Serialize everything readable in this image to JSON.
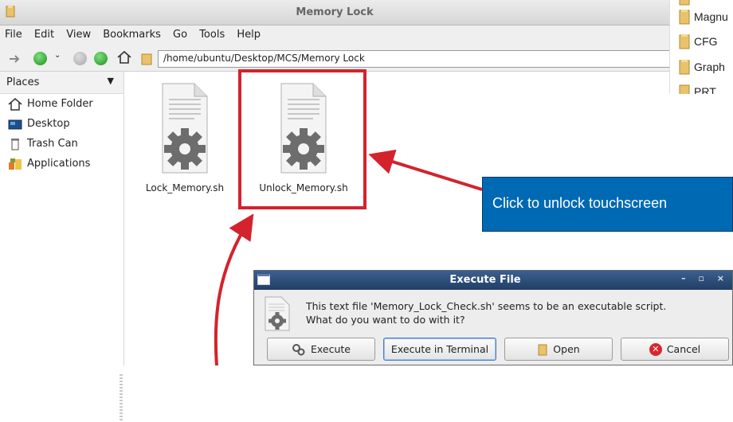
{
  "window": {
    "title": "Memory Lock"
  },
  "menu": [
    "File",
    "Edit",
    "View",
    "Bookmarks",
    "Go",
    "Tools",
    "Help"
  ],
  "toolbar": {
    "path": "/home/ubuntu/Desktop/MCS/Memory Lock"
  },
  "sidebar": {
    "header": "Places",
    "items": [
      {
        "label": "Home Folder",
        "icon": "home-icon"
      },
      {
        "label": "Desktop",
        "icon": "desktop-icon"
      },
      {
        "label": "Trash Can",
        "icon": "trash-icon"
      },
      {
        "label": "Applications",
        "icon": "applications-icon"
      }
    ]
  },
  "files": [
    {
      "name": "Lock_Memory.sh",
      "icon": "script-file-icon"
    },
    {
      "name": "Unlock_Memory.sh",
      "icon": "script-file-icon"
    }
  ],
  "callout": {
    "text": "Click to unlock touchscreen"
  },
  "right_list": [
    "Magnu",
    "CFG",
    "Graph",
    "PRT"
  ],
  "dialog": {
    "title": "Execute File",
    "controls": "– ▫ ×",
    "message_line1": "This text file 'Memory_Lock_Check.sh' seems to be an executable script.",
    "message_line2": "What do you want to do with it?",
    "buttons": {
      "execute": "Execute",
      "execute_terminal": "Execute in Terminal",
      "open": "Open",
      "cancel": "Cancel"
    }
  },
  "colors": {
    "highlight": "#d3232d",
    "callout_bg": "#0069b4",
    "arrow": "#d3232d",
    "dialog_title": "#2b4a75"
  }
}
